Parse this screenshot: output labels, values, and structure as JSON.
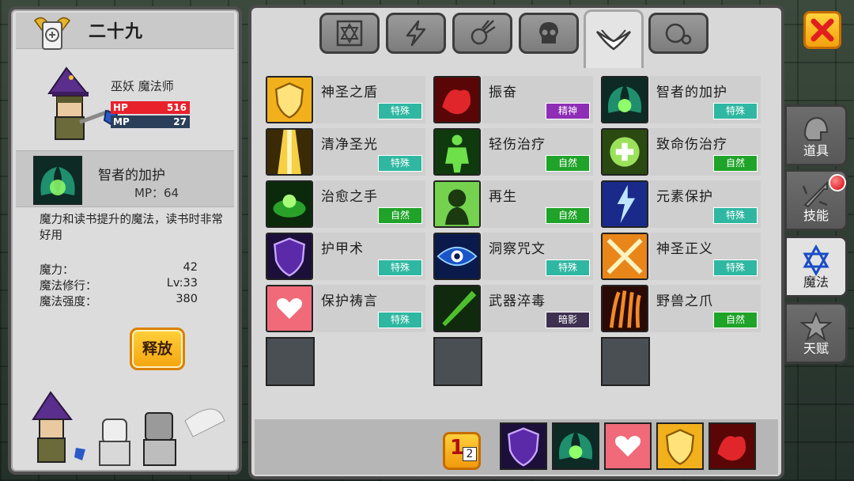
{
  "hero": {
    "name": "二十九",
    "class_name": "巫妖 魔法师",
    "hp_label": "HP",
    "hp_value": "516",
    "mp_label": "MP",
    "mp_value": "27"
  },
  "selected_skill": {
    "name": "智者的加护",
    "mp_cost": "MP：64",
    "description": "魔力和读书提升的魔法，读书时非常好用",
    "stats": [
      {
        "key": "魔力：",
        "value": "42"
      },
      {
        "key": "魔法修行：",
        "value": "Lv:33"
      },
      {
        "key": "魔法强度：",
        "value": "380"
      }
    ],
    "release_label": "释放"
  },
  "category_tabs": [
    {
      "icon": "hexagram-icon"
    },
    {
      "icon": "lightning-icon"
    },
    {
      "icon": "comet-icon"
    },
    {
      "icon": "skull-icon"
    },
    {
      "icon": "wings-icon",
      "active": true
    },
    {
      "icon": "bubbles-icon"
    }
  ],
  "skills": [
    {
      "name": "神圣之盾",
      "tag": "特殊",
      "tag_color": "#2fb7a1",
      "icon_color": "#f2b01c"
    },
    {
      "name": "振奋",
      "tag": "精神",
      "tag_color": "#8e2db5",
      "icon_color": "#c8191f"
    },
    {
      "name": "智者的加护",
      "tag": "特殊",
      "tag_color": "#2fb7a1",
      "icon_color": "#1c8e6a"
    },
    {
      "name": "清净圣光",
      "tag": "特殊",
      "tag_color": "#2fb7a1",
      "icon_color": "#d6a21a"
    },
    {
      "name": "轻伤治疗",
      "tag": "自然",
      "tag_color": "#1fa329",
      "icon_color": "#4fbf2e"
    },
    {
      "name": "致命伤治疗",
      "tag": "自然",
      "tag_color": "#1fa329",
      "icon_color": "#6acc3a"
    },
    {
      "name": "治愈之手",
      "tag": "自然",
      "tag_color": "#1fa329",
      "icon_color": "#2aa22a"
    },
    {
      "name": "再生",
      "tag": "自然",
      "tag_color": "#1fa329",
      "icon_color": "#5fcf3f"
    },
    {
      "name": "元素保护",
      "tag": "特殊",
      "tag_color": "#2fb7a1",
      "icon_color": "#3a4ed8"
    },
    {
      "name": "护甲术",
      "tag": "特殊",
      "tag_color": "#2fb7a1",
      "icon_color": "#5b2aa8"
    },
    {
      "name": "洞察咒文",
      "tag": "特殊",
      "tag_color": "#2fb7a1",
      "icon_color": "#1a55c8"
    },
    {
      "name": "神圣正义",
      "tag": "特殊",
      "tag_color": "#2fb7a1",
      "icon_color": "#e8861a"
    },
    {
      "name": "保护祷言",
      "tag": "特殊",
      "tag_color": "#2fb7a1",
      "icon_color": "#e8445a"
    },
    {
      "name": "武器淬毒",
      "tag": "暗影",
      "tag_color": "#3d3050",
      "icon_color": "#2a7a1e"
    },
    {
      "name": "野兽之爪",
      "tag": "自然",
      "tag_color": "#1fa329",
      "icon_color": "#b84a14"
    }
  ],
  "quick_bar": {
    "page_label": "1",
    "page_label_alt": "2",
    "slots": [
      {
        "icon_color": "#5b2aa8"
      },
      {
        "icon_color": "#1c8e6a"
      },
      {
        "icon_color": "#e8445a"
      },
      {
        "icon_color": "#f2b01c"
      },
      {
        "icon_color": "#c8191f"
      }
    ]
  },
  "side_tabs": [
    {
      "label": "道具",
      "icon": "helmet-icon"
    },
    {
      "label": "技能",
      "icon": "sword-icon"
    },
    {
      "label": "魔法",
      "icon": "hexagram-icon",
      "active": true
    },
    {
      "label": "天赋",
      "icon": "star-icon"
    }
  ],
  "colors": {
    "accent_yellow": "#f4a510",
    "close_x": "#e0201e"
  }
}
